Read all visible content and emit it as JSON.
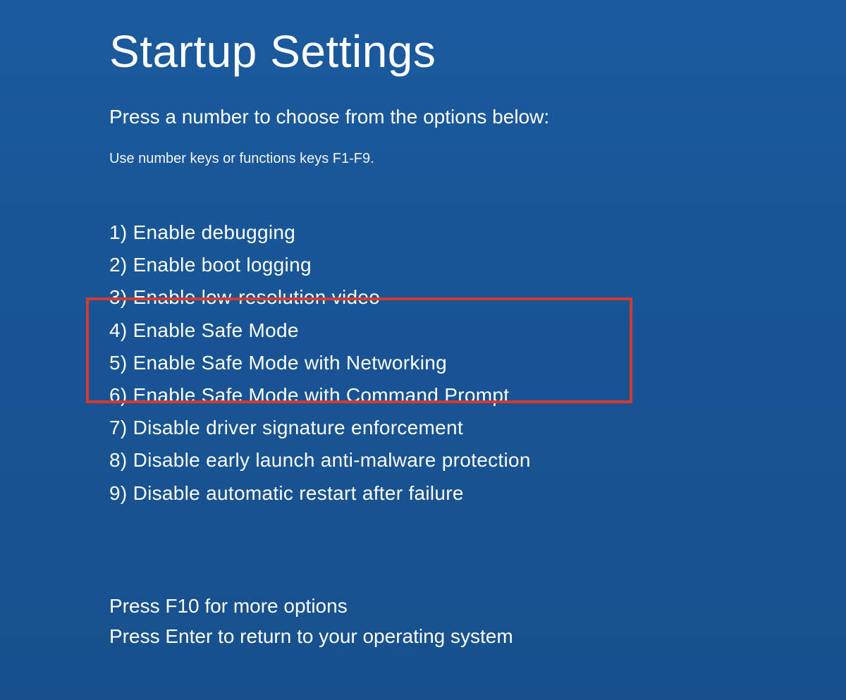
{
  "title": "Startup Settings",
  "subtitle": "Press a number to choose from the options below:",
  "instruction": "Use number keys or functions keys F1-F9.",
  "options": [
    "1) Enable debugging",
    "2) Enable boot logging",
    "3) Enable low-resolution video",
    "4) Enable Safe Mode",
    "5) Enable Safe Mode with Networking",
    "6) Enable Safe Mode with Command Prompt",
    "7) Disable driver signature enforcement",
    "8) Disable early launch anti-malware protection",
    "9) Disable automatic restart after failure"
  ],
  "footer": {
    "more_options": "Press F10 for more options",
    "return_text": "Press Enter to return to your operating system"
  }
}
